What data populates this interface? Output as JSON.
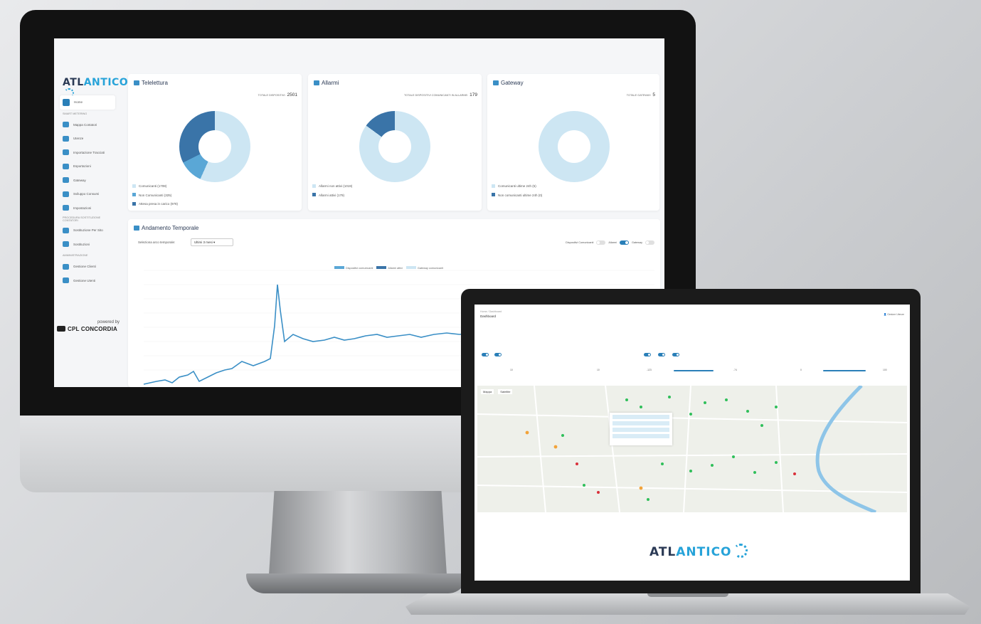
{
  "imac": {
    "logo": {
      "dark": "ATL",
      "accent": "ANTICO"
    },
    "sidebar": {
      "home": "Home",
      "section_smart": "SMART METERING",
      "items": [
        "Mappa Contatori",
        "Utenze",
        "Importazione Tracciati",
        "Esportazioni",
        "Gateway",
        "Sviluppo Consumi",
        "Impostazioni"
      ],
      "section_lv": "PROCEDURA SOSTITUZIONE CONTATORI",
      "items2": [
        "Sostituzione Per Sito",
        "Sostituzioni"
      ],
      "section_admin": "AMMINISTRAZIONE",
      "items3": [
        "Gestione Clienti",
        "Gestione Utenti"
      ]
    },
    "powered_by": "powered by",
    "brand": "CPL CONCORDIA",
    "cards": [
      {
        "title": "Telelettura",
        "total_label": "TOTALE DISPOSITIVI:",
        "total": "2501",
        "legend": [
          "Comunicanti (1708)",
          "Non Comunicanti (325)",
          "Attesa presa in carico (978)"
        ]
      },
      {
        "title": "Allarmi",
        "total_label": "TOTALE DISPOSITIVI COMUNICANTI IN ALLARME:",
        "total": "179",
        "legend": [
          "Allarmi non attivi (1019)",
          "Allarmi attivi (179)"
        ]
      },
      {
        "title": "Gateway",
        "total_label": "TOTALE GATEWAY:",
        "total": "5",
        "legend": [
          "Comunicanti ultime 24h (5)",
          "Non comunicanti ultime 24h (0)"
        ]
      }
    ],
    "trend": {
      "title": "Andamento Temporale",
      "select_label": "Seleziona arco temporale:",
      "select_value": "Ultimi 3 mesi",
      "toggles": [
        "Dispositivi Comunicanti",
        "Allarmi",
        "Gateway"
      ],
      "legend": [
        "Dispositivi comunicanti",
        "Allarmi attivi",
        "Gateway comunicanti"
      ]
    }
  },
  "laptop": {
    "breadcrumb": "Home / Dashboard",
    "title": "Dashboard",
    "user": "Gestore Utenze",
    "map_tabs": [
      "Mappa",
      "Satellite"
    ],
    "values": [
      "10",
      "10",
      "-123",
      "-74",
      "0",
      "100"
    ],
    "logo": {
      "dark": "ATL",
      "accent": "ANTICO"
    }
  },
  "colors": {
    "dark_blue": "#3a74a8",
    "mid_blue": "#5aa7d6",
    "light_blue": "#cde6f3",
    "accent": "#27a3d9",
    "brand_dark": "#2b3a55"
  },
  "chart_data": [
    {
      "type": "pie",
      "title": "Telelettura",
      "categories": [
        "Comunicanti",
        "Non Comunicanti",
        "Attesa presa in carico"
      ],
      "values": [
        1708,
        325,
        978
      ]
    },
    {
      "type": "pie",
      "title": "Allarmi",
      "categories": [
        "Allarmi non attivi",
        "Allarmi attivi"
      ],
      "values": [
        1019,
        179
      ]
    },
    {
      "type": "pie",
      "title": "Gateway",
      "categories": [
        "Comunicanti ultime 24h",
        "Non comunicanti ultime 24h"
      ],
      "values": [
        5,
        0
      ]
    }
  ]
}
